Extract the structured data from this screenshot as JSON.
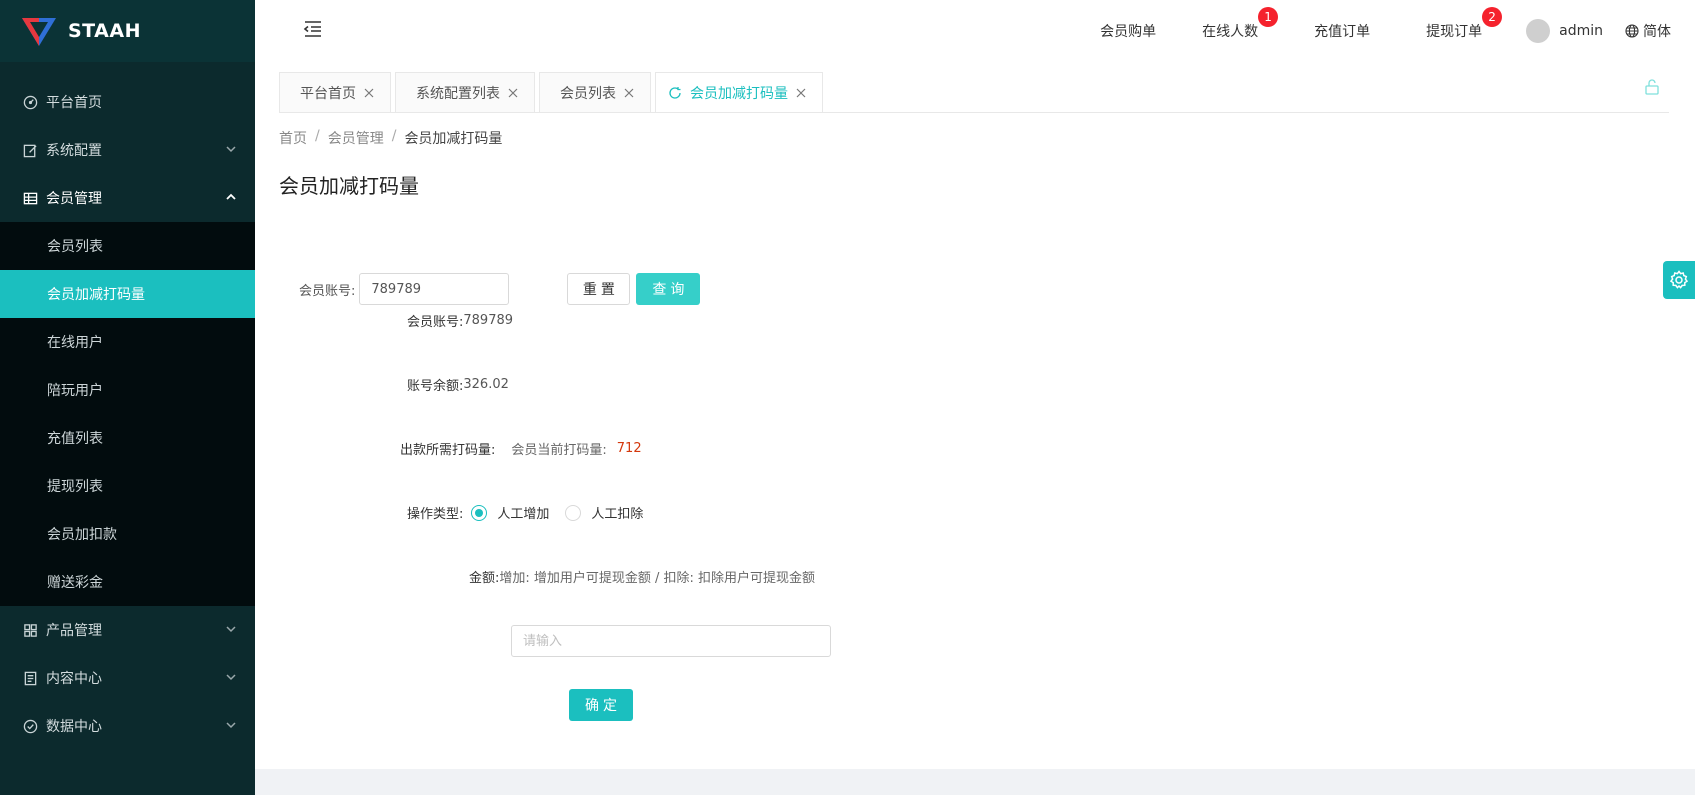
{
  "brand": {
    "name": "STAAH",
    "colors": {
      "accent": "#1bbfbf",
      "sidebar": "#0c2a2d",
      "badge": "#f5222d",
      "value_red": "#d4380d"
    }
  },
  "sidebar": {
    "items": [
      {
        "label": "平台首页",
        "icon": "dashboard-icon"
      },
      {
        "label": "系统配置",
        "icon": "edit-icon",
        "expandable": true
      },
      {
        "label": "会员管理",
        "icon": "table-icon",
        "expandable": true,
        "open": true,
        "children": [
          "会员列表",
          "会员加减打码量",
          "在线用户",
          "陪玩用户",
          "充值列表",
          "提现列表",
          "会员加扣款",
          "赠送彩金"
        ],
        "active_child": "会员加减打码量"
      },
      {
        "label": "产品管理",
        "icon": "grid-icon",
        "expandable": true
      },
      {
        "label": "内容中心",
        "icon": "document-icon",
        "expandable": true
      },
      {
        "label": "数据中心",
        "icon": "check-circle-icon",
        "expandable": true
      }
    ]
  },
  "header": {
    "links": [
      {
        "label": "会员购单"
      },
      {
        "label": "在线人数",
        "badge": "1"
      },
      {
        "label": "充值订单"
      },
      {
        "label": "提现订单",
        "badge": "2"
      }
    ],
    "user": "admin",
    "language": "简体"
  },
  "tabs": [
    {
      "label": "平台首页"
    },
    {
      "label": "系统配置列表"
    },
    {
      "label": "会员列表"
    },
    {
      "label": "会员加减打码量",
      "active": true
    }
  ],
  "breadcrumb": [
    "首页",
    "会员管理",
    "会员加减打码量"
  ],
  "page_title": "会员加减打码量",
  "search": {
    "label": "会员账号:",
    "value": "789789",
    "reset_label": "重置",
    "query_label": "查询"
  },
  "detail": {
    "account_label": "会员账号:",
    "account_value": "789789",
    "balance_label": "账号余额:",
    "balance_value": "326.02",
    "required_label": "出款所需打码量:",
    "current_label": "会员当前打码量:",
    "current_value": "712",
    "op_label": "操作类型:",
    "op_options": [
      "人工增加",
      "人工扣除"
    ],
    "op_selected": "人工增加",
    "amount_label": "金额:",
    "amount_hint": "增加: 增加用户可提现金额 / 扣除: 扣除用户可提现金额",
    "amount_placeholder": "请输入",
    "confirm_label": "确定"
  }
}
